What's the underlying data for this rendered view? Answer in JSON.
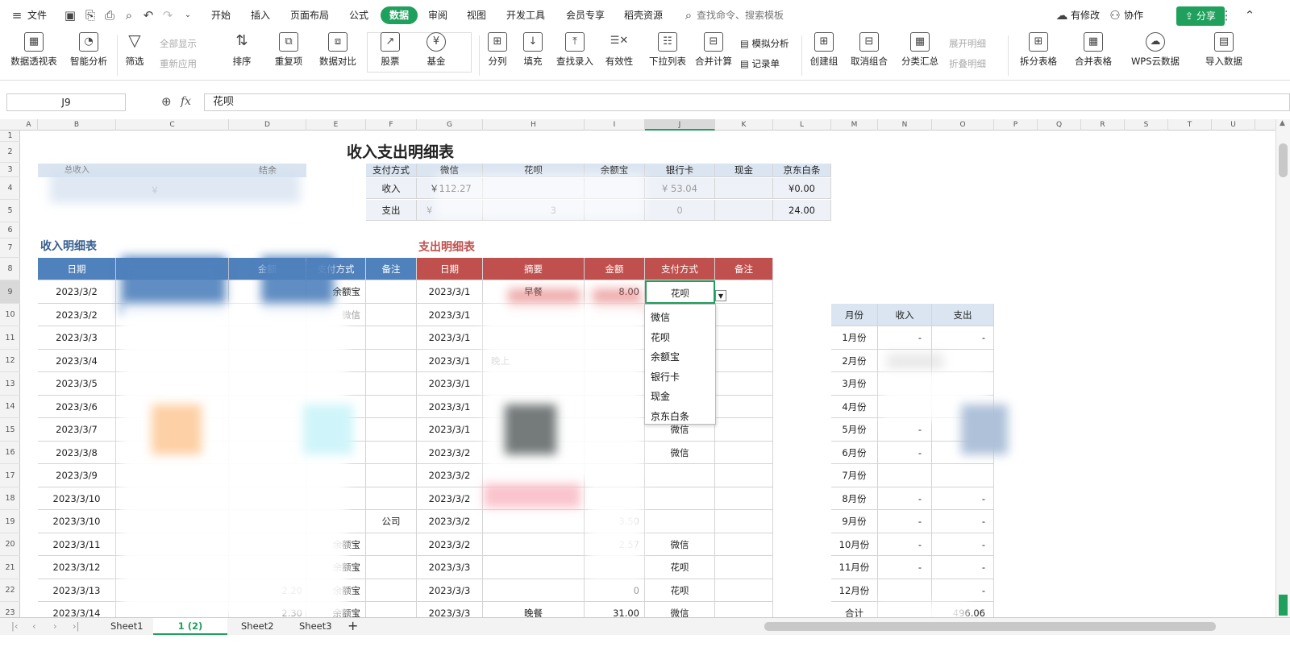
{
  "menu": {
    "file": "文件",
    "tabs": [
      "开始",
      "插入",
      "页面布局",
      "公式",
      "数据",
      "审阅",
      "视图",
      "开发工具",
      "会员专享",
      "稻壳资源"
    ],
    "search": "查找命令、搜索模板",
    "modified": "有修改",
    "collab": "协作",
    "share": "分享"
  },
  "ribbon": {
    "pivot": "数据透视表",
    "smart": "智能分析",
    "filter": "筛选",
    "show_all": "全部显示",
    "reapply": "重新应用",
    "sort": "排序",
    "dup": "重复项",
    "compare": "数据对比",
    "stock": "股票",
    "fund": "基金",
    "split": "分列",
    "fill": "填充",
    "lookup": "查找录入",
    "valid": "有效性",
    "droplist": "下拉列表",
    "merge": "合并计算",
    "simulate": "模拟分析",
    "record": "记录单",
    "group": "创建组",
    "ungroup": "取消组合",
    "subtotal": "分类汇总",
    "expand": "展开明细",
    "collapse": "折叠明细",
    "split_table": "拆分表格",
    "merge_table": "合并表格",
    "wps_cloud": "WPS云数据",
    "import": "导入数据"
  },
  "formula": {
    "cell": "J9",
    "fx": "fx",
    "value": "花呗"
  },
  "columns": [
    "A",
    "B",
    "C",
    "D",
    "E",
    "F",
    "G",
    "H",
    "I",
    "J",
    "K",
    "L",
    "M",
    "N",
    "O",
    "P",
    "Q",
    "R",
    "S",
    "T",
    "U"
  ],
  "rows": [
    "1",
    "2",
    "3",
    "4",
    "5",
    "6",
    "7",
    "8",
    "9",
    "10",
    "11",
    "12",
    "13",
    "14",
    "15",
    "16",
    "17",
    "18",
    "19",
    "20",
    "21",
    "22",
    "23"
  ],
  "title": "收入支出明细表",
  "summary": {
    "total_income": "总收入",
    "balance": "结余",
    "c4": "￥"
  },
  "pay": {
    "hdr": [
      "支付方式",
      "微信",
      "花呗",
      "余额宝",
      "银行卡",
      "现金",
      "京东白条"
    ],
    "income_label": "收入",
    "income_wx": "￥112.27",
    "income_card": "¥ 53.04",
    "income_jd": "¥0.00",
    "expense_label": "支出",
    "expense_wx": "¥",
    "expense_hb": "3",
    "expense_card": "0",
    "expense_jd": "24.00"
  },
  "income": {
    "title": "收入明细表",
    "hdr": [
      "日期",
      "",
      "金额",
      "支付方式",
      "备注"
    ],
    "dates": [
      "2023/3/2",
      "2023/3/2",
      "2023/3/3",
      "2023/3/4",
      "2023/3/5",
      "2023/3/6",
      "2023/3/7",
      "2023/3/8",
      "2023/3/9",
      "2023/3/10",
      "2023/3/10",
      "2023/3/11",
      "2023/3/12",
      "2023/3/13",
      "2023/3/14"
    ],
    "pay": [
      "余额宝",
      "微信",
      "",
      "",
      "",
      "",
      "",
      "",
      "",
      "",
      "",
      "余额宝",
      "余额宝",
      "余额宝",
      "余额宝"
    ],
    "amount": [
      "",
      "",
      "",
      "",
      "",
      "",
      "",
      "",
      "",
      "",
      "",
      "",
      "",
      "2.20",
      "2.30"
    ],
    "note10": "公司"
  },
  "expense": {
    "title": "支出明细表",
    "hdr": [
      "日期",
      "摘要",
      "金额",
      "支付方式",
      "备注"
    ],
    "dates": [
      "2023/3/1",
      "2023/3/1",
      "2023/3/1",
      "2023/3/1",
      "2023/3/1",
      "2023/3/1",
      "2023/3/1",
      "2023/3/2",
      "2023/3/2",
      "2023/3/2",
      "2023/3/2",
      "2023/3/2",
      "2023/3/3",
      "2023/3/3",
      "2023/3/3"
    ],
    "summary": [
      "早餐",
      "",
      "",
      "晚上",
      "",
      "",
      "",
      "",
      "",
      "",
      "",
      "",
      "",
      "",
      "晚餐"
    ],
    "amount": [
      "8.00",
      "",
      "",
      "",
      "",
      "",
      "",
      "",
      "",
      "",
      "3.50",
      "2.57",
      "",
      "0",
      "31.00"
    ],
    "pay": [
      "花呗",
      "",
      "",
      "",
      "",
      "",
      "微信",
      "微信",
      "",
      "",
      "",
      "微信",
      "花呗",
      "花呗",
      "微信"
    ]
  },
  "dropdown": [
    "微信",
    "花呗",
    "余额宝",
    "银行卡",
    "现金",
    "京东白条"
  ],
  "monthly": {
    "hdr": [
      "月份",
      "收入",
      "支出"
    ],
    "months": [
      "1月份",
      "2月份",
      "3月份",
      "4月份",
      "5月份",
      "6月份",
      "7月份",
      "8月份",
      "9月份",
      "10月份",
      "11月份",
      "12月份",
      "合计"
    ],
    "income": [
      "-",
      "",
      "",
      "",
      "-",
      "-",
      "",
      "-",
      "-",
      "-",
      "-",
      "",
      ""
    ],
    "expense": [
      "-",
      "",
      "",
      "",
      "",
      "",
      "",
      "-",
      "-",
      "-",
      "-",
      "-",
      "496.06"
    ]
  },
  "sheets": [
    "Sheet1",
    "1 (2)",
    "Sheet2",
    "Sheet3"
  ],
  "accent": "#1fa05c"
}
